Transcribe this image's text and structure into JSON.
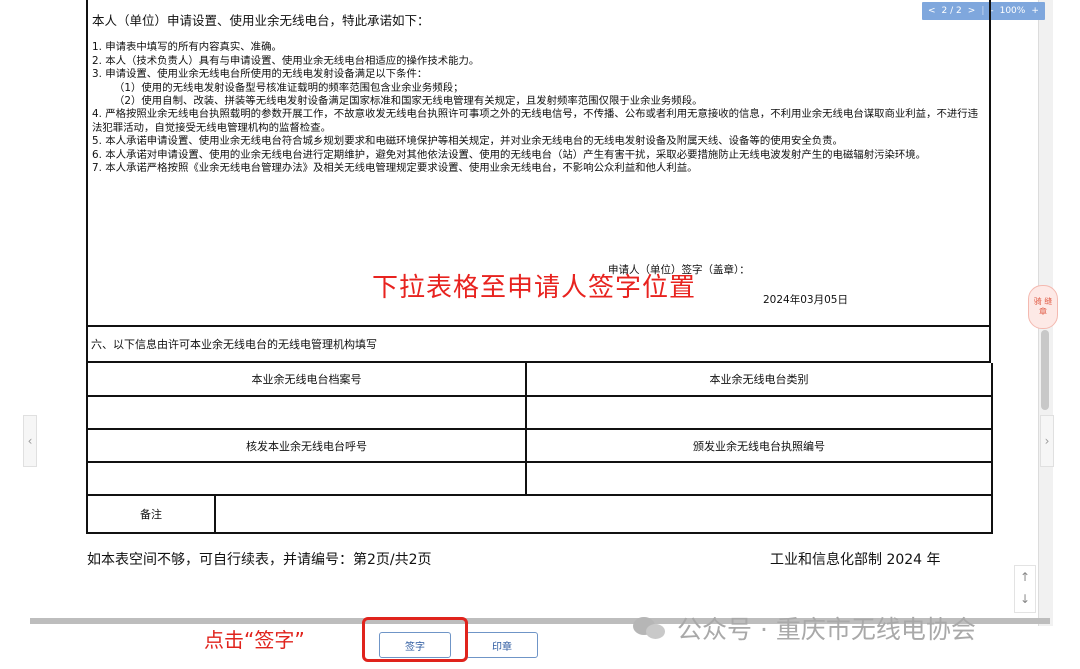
{
  "pager": {
    "prev": "<",
    "page": "2 / 2",
    "next": ">",
    "zoom_out": "-",
    "zoom": "100%",
    "zoom_in": "+"
  },
  "pledge": {
    "intro": "本人（单位）申请设置、使用业余无线电台，特此承诺如下：",
    "items": [
      "1. 申请表中填写的所有内容真实、准确。",
      "2. 本人（技术负责人）具有与申请设置、使用业余无线电台相适应的操作技术能力。",
      "3. 申请设置、使用业余无线电台所使用的无线电发射设备满足以下条件：",
      "（1）使用的无线电发射设备型号核准证载明的频率范围包含业余业务频段；",
      "（2）使用自制、改装、拼装等无线电发射设备满足国家标准和国家无线电管理有关规定，且发射频率范围仅限于业余业务频段。",
      "4. 严格按照业余无线电台执照载明的参数开展工作，不故意收发无线电台执照许可事项之外的无线电信号，不传播、公布或者利用无意接收的信息，不利用业余无线电台谋取商业利益，不进行违法犯罪活动，自觉接受无线电管理机构的监督检查。",
      "5. 本人承诺申请设置、使用业余无线电台符合城乡规划要求和电磁环境保护等相关规定，并对业余无线电台的无线电发射设备及附属天线、设备等的使用安全负责。",
      "6. 本人承诺对申请设置、使用的业余无线电台进行定期维护，避免对其他依法设置、使用的无线电台（站）产生有害干扰，采取必要措施防止无线电波发射产生的电磁辐射污染环境。",
      "7. 本人承诺严格按照《业余无线电台管理办法》及相关无线电管理规定要求设置、使用业余无线电台，不影响公众利益和他人利益。"
    ],
    "signature_label": "申请人（单位）签字（盖章）：",
    "date": "2024年03月05日"
  },
  "overlay_hint": "下拉表格至申请人签字位置",
  "section6": {
    "title": "六、以下信息由许可本业余无线电台的无线电管理机构填写",
    "row1": [
      "本业余无线电台档案号",
      "本业余无线电台类别"
    ],
    "row2": [
      "核发本业余无线电台呼号",
      "颁发业余无线电台执照编号"
    ],
    "note_label": "备注"
  },
  "footer": {
    "left": "如本表空间不够，可自行续表，并请编号：第2页/共2页",
    "right": "工业和信息化部制 2024 年"
  },
  "buttons": {
    "sign": "签字",
    "seal": "印章"
  },
  "click_hint": "点击“签字”",
  "watermark": "公众号 · 重庆市无线电协会",
  "side_badge": "骑 缝 章",
  "scroll_up": "↑",
  "scroll_down": "↓",
  "handle_left": "‹",
  "handle_right": "›"
}
